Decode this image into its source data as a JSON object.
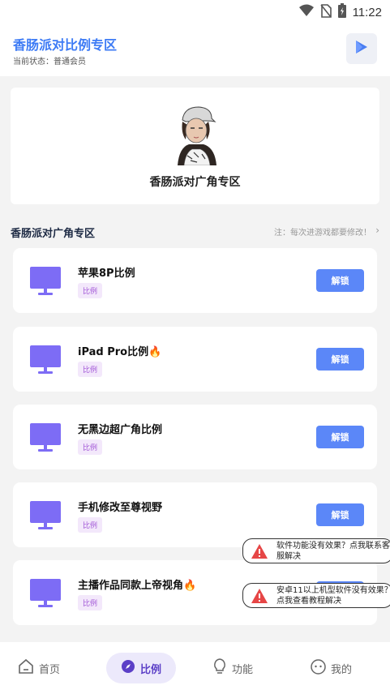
{
  "status_bar": {
    "time": "11:22"
  },
  "header": {
    "title": "香肠派对比例专区",
    "subtitle": "当前状态：普通会员"
  },
  "hero": {
    "title": "香肠派对广角专区"
  },
  "section": {
    "title": "香肠派对广角专区",
    "note": "注：每次进游戏都要修改！"
  },
  "items": [
    {
      "name": "苹果8P比例",
      "tag": "比例",
      "button": "解锁",
      "hot": false
    },
    {
      "name": "iPad Pro比例",
      "tag": "比例",
      "button": "解锁",
      "hot": true
    },
    {
      "name": "无黑边超广角比例",
      "tag": "比例",
      "button": "解锁",
      "hot": false
    },
    {
      "name": "手机修改至尊视野",
      "tag": "比例",
      "button": "解锁",
      "hot": false
    },
    {
      "name": "主播作品同款上帝视角",
      "tag": "比例",
      "button": "解锁",
      "hot": true
    }
  ],
  "tips": [
    {
      "text": "软件功能没有效果？点我联系客服解决"
    },
    {
      "text": "安卓11以上机型软件没有效果？点我查看教程解决"
    }
  ],
  "bottom_nav": [
    {
      "label": "首页",
      "icon": "home-icon"
    },
    {
      "label": "比例",
      "icon": "compass-icon"
    },
    {
      "label": "功能",
      "icon": "bulb-icon"
    },
    {
      "label": "我的",
      "icon": "face-icon"
    }
  ],
  "colors": {
    "accent_blue": "#3d7bf5",
    "button_blue": "#5b87f8",
    "monitor_purple": "#7d6cf5",
    "tag_purple": "#a054d6",
    "nav_active_bg": "#ece9fb",
    "warn_red": "#e64646"
  }
}
